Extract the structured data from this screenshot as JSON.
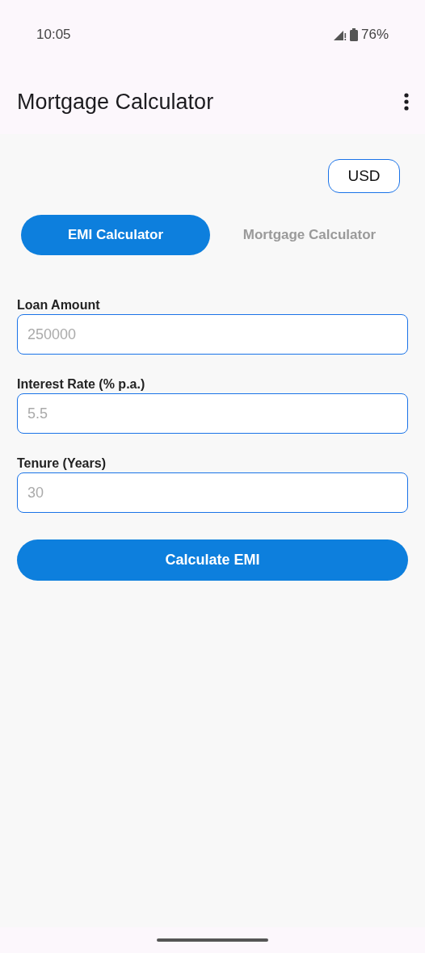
{
  "status_bar": {
    "time": "10:05",
    "battery": "76%"
  },
  "app_bar": {
    "title": "Mortgage Calculator"
  },
  "currency_button": "USD",
  "tabs": [
    {
      "label": "EMI Calculator",
      "selected": true
    },
    {
      "label": "Mortgage Calculator",
      "selected": false
    }
  ],
  "fields": [
    {
      "label": "Loan Amount",
      "placeholder": "250000"
    },
    {
      "label": "Interest Rate (% p.a.)",
      "placeholder": "5.5"
    },
    {
      "label": "Tenure (Years)",
      "placeholder": "30"
    }
  ],
  "calculate_button": "Calculate EMI"
}
